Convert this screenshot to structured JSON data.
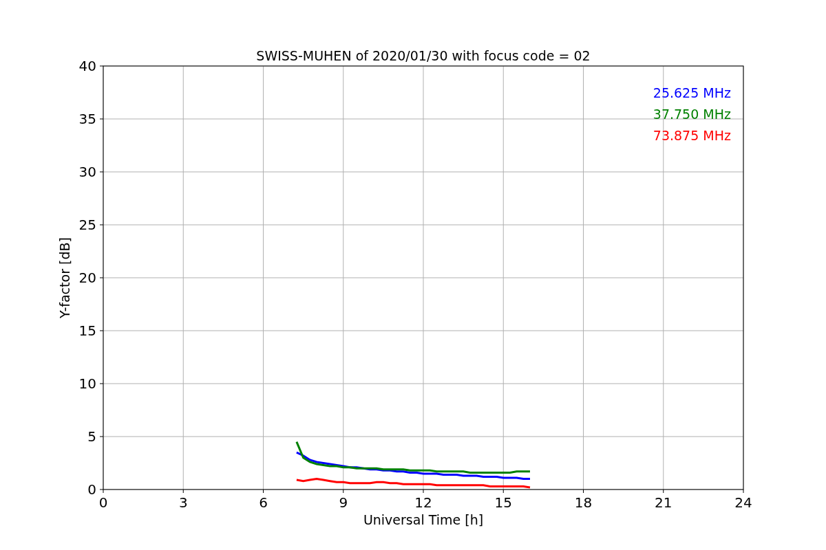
{
  "figure": {
    "chart_data": {
      "type": "line",
      "title": "SWISS-MUHEN of 2020/01/30 with focus code = 02",
      "xlabel": "Universal Time [h]",
      "ylabel": "Y-factor [dB]",
      "x": [
        7.25,
        7.5,
        7.75,
        8,
        8.25,
        8.5,
        8.75,
        9,
        9.25,
        9.5,
        9.75,
        10,
        10.25,
        10.5,
        10.75,
        11,
        11.25,
        11.5,
        11.75,
        12,
        12.25,
        12.5,
        12.75,
        13,
        13.25,
        13.5,
        13.75,
        14,
        14.25,
        14.5,
        14.75,
        15,
        15.25,
        15.5,
        15.75,
        16
      ],
      "series": [
        {
          "name": "25.625 MHz",
          "color": "#0000ff",
          "values": [
            3.5,
            3.2,
            2.8,
            2.6,
            2.5,
            2.4,
            2.3,
            2.2,
            2.1,
            2.1,
            2.0,
            1.9,
            1.9,
            1.8,
            1.8,
            1.7,
            1.7,
            1.6,
            1.6,
            1.5,
            1.5,
            1.5,
            1.4,
            1.4,
            1.4,
            1.3,
            1.3,
            1.3,
            1.2,
            1.2,
            1.2,
            1.1,
            1.1,
            1.1,
            1.0,
            1.0
          ]
        },
        {
          "name": "37.750 MHz",
          "color": "#008000",
          "values": [
            4.5,
            3.0,
            2.6,
            2.4,
            2.3,
            2.2,
            2.2,
            2.1,
            2.1,
            2.0,
            2.0,
            2.0,
            2.0,
            1.9,
            1.9,
            1.9,
            1.9,
            1.8,
            1.8,
            1.8,
            1.8,
            1.7,
            1.7,
            1.7,
            1.7,
            1.7,
            1.6,
            1.6,
            1.6,
            1.6,
            1.6,
            1.6,
            1.6,
            1.7,
            1.7,
            1.7
          ]
        },
        {
          "name": "73.875 MHz",
          "color": "#ff0000",
          "values": [
            0.9,
            0.8,
            0.9,
            1.0,
            0.9,
            0.8,
            0.7,
            0.7,
            0.6,
            0.6,
            0.6,
            0.6,
            0.7,
            0.7,
            0.6,
            0.6,
            0.5,
            0.5,
            0.5,
            0.5,
            0.5,
            0.4,
            0.4,
            0.4,
            0.4,
            0.4,
            0.4,
            0.4,
            0.4,
            0.3,
            0.3,
            0.3,
            0.3,
            0.3,
            0.3,
            0.2
          ]
        }
      ],
      "xlim": [
        0,
        24
      ],
      "ylim": [
        0,
        40
      ],
      "xticks": [
        0,
        3,
        6,
        9,
        12,
        15,
        18,
        21,
        24
      ],
      "yticks": [
        0,
        5,
        10,
        15,
        20,
        25,
        30,
        35,
        40
      ],
      "grid": true
    }
  }
}
